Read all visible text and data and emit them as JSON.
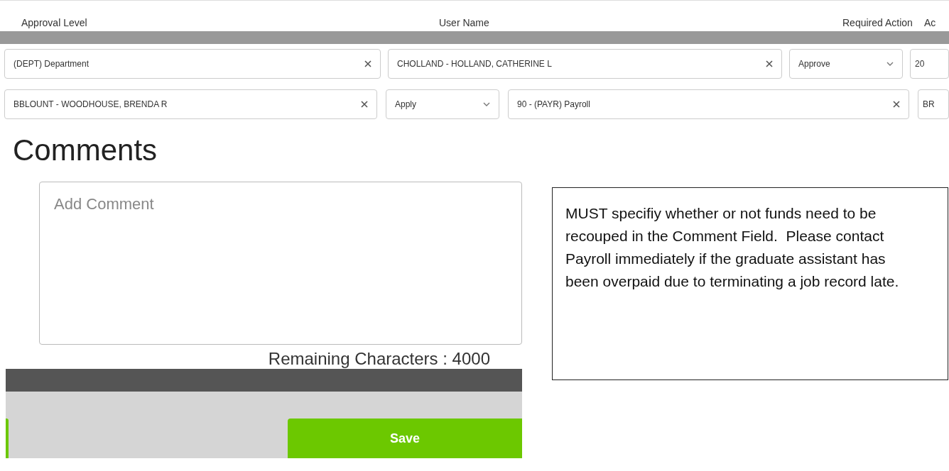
{
  "table": {
    "columns": [
      "Approval Level",
      "User Name",
      "Required Action",
      "Ac"
    ],
    "rows": [
      {
        "cells": [
          {
            "kind": "select",
            "value": "(DEPT) Department",
            "clearable": true
          },
          {
            "kind": "select",
            "value": "CHOLLAND - HOLLAND, CATHERINE L",
            "clearable": true
          },
          {
            "kind": "select",
            "value": "Approve",
            "clearable": false
          },
          {
            "kind": "text",
            "value": "20"
          }
        ]
      },
      {
        "cells": [
          {
            "kind": "select",
            "value": "BBLOUNT - WOODHOUSE, BRENDA R",
            "clearable": true
          },
          {
            "kind": "select",
            "value": "Apply",
            "clearable": false
          },
          {
            "kind": "select",
            "value": "90 - (PAYR) Payroll",
            "clearable": true
          },
          {
            "kind": "text",
            "value": "BR"
          }
        ]
      }
    ]
  },
  "comments": {
    "title": "Comments",
    "placeholder": "Add Comment",
    "remaining": "Remaining Characters : 4000",
    "save": "Save"
  },
  "note": "MUST specifiy whether or not funds need to be recouped in the Comment Field.  Please contact Payroll immediately if the graduate assistant has been overpaid due to terminating a job record late."
}
